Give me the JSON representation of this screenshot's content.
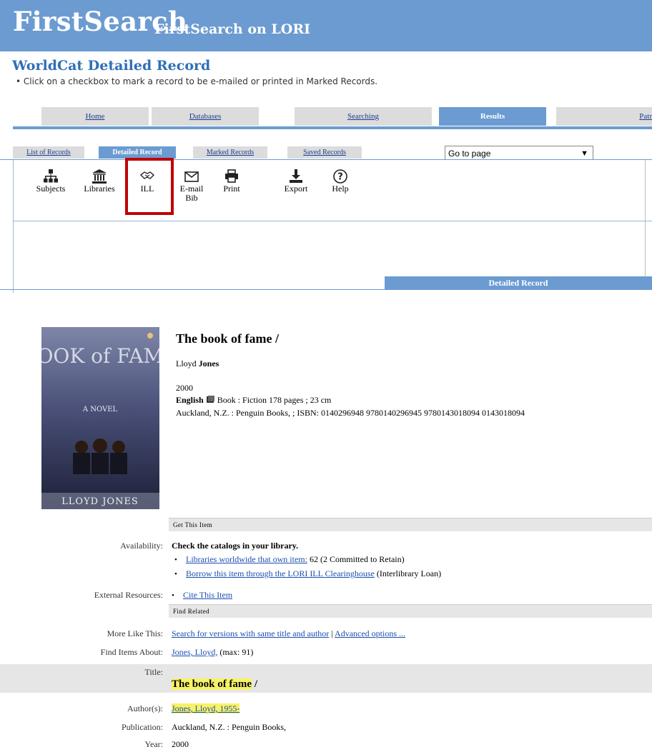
{
  "header": {
    "brand": "FirstSearch",
    "subtitle": "FirstSearch on LORI",
    "page_title": "WorldCat Detailed Record",
    "instruction": "• Click on a checkbox to mark a record to be e-mailed or printed in Marked Records."
  },
  "main_tabs": [
    {
      "label": "Home"
    },
    {
      "label": "Databases"
    },
    {
      "label": "Searching"
    },
    {
      "label": "Results",
      "active": true
    },
    {
      "label": "Patr"
    }
  ],
  "sub_tabs": [
    {
      "label": "List of Records"
    },
    {
      "label": "Detailed Record",
      "active": true
    },
    {
      "label": "Marked Records"
    },
    {
      "label": "Saved Records"
    }
  ],
  "goto_select": {
    "value": "Go to page"
  },
  "toolbar": [
    {
      "label": "Subjects",
      "icon": "sitemap-icon"
    },
    {
      "label": "Libraries",
      "icon": "library-icon"
    },
    {
      "label": "ILL",
      "icon": "handshake-icon"
    },
    {
      "label": "E-mail",
      "label2": "Bib",
      "icon": "envelope-icon"
    },
    {
      "label": "Print",
      "icon": "printer-icon"
    },
    {
      "label": "Export",
      "icon": "download-icon"
    },
    {
      "label": "Help",
      "icon": "question-icon"
    }
  ],
  "highlight_color": "#c00000",
  "accent_color": "#6b9bd1",
  "detailed_record_bar": "Detailed Record",
  "record": {
    "title": "The book of fame /",
    "author_first": "Lloyd",
    "author_last": "Jones",
    "year": "2000",
    "language": "English",
    "format_line": "Book : Fiction 178 pages ; 23 cm",
    "pub_line": "Auckland, N.Z. : Penguin Books, ; ISBN: 0140296948 9780140296945 9780143018094 0143018094"
  },
  "cover": {
    "title_art": "BOOK of FAME",
    "subtitle": "A NOVEL",
    "author": "LLOYD JONES"
  },
  "sections": {
    "get_item": "Get This Item",
    "find_related": "Find Related"
  },
  "details": {
    "availability_label": "Availability:",
    "availability_head": "Check the catalogs in your library.",
    "avail_link1": "Libraries worldwide that own item:",
    "avail_link1_tail": "62 (2 Committed to Retain)",
    "avail_link2": "Borrow this item through the LORI ILL Clearinghouse",
    "avail_link2_tail": "(Interlibrary Loan)",
    "external_label": "External Resources:",
    "external_link": "Cite This Item",
    "more_like_label": "More Like This:",
    "more_like_link1": "Search for versions with same title and author",
    "more_like_sep": "|",
    "more_like_link2": "Advanced options ...",
    "find_about_label": "Find Items About:",
    "find_about_link": "Jones, Lloyd,",
    "find_about_tail": "(max: 91)",
    "title_label": "Title:",
    "title_value": "The book of fame",
    "title_slash": "/",
    "authors_label": "Author(s):",
    "authors_value": "Jones, Lloyd, 1955-",
    "publication_label": "Publication:",
    "publication_value": "Auckland, N.Z. : Penguin Books,",
    "year_label": "Year:",
    "year_value": "2000"
  }
}
